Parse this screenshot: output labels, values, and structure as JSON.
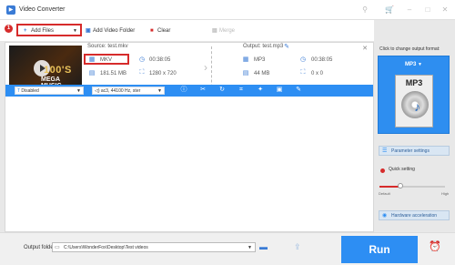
{
  "window": {
    "title": "Video Converter",
    "controls": [
      "key-icon",
      "cart-icon",
      "minimize-icon",
      "maximize-icon",
      "close-icon"
    ]
  },
  "toolbar": {
    "add_files": "Add Files",
    "add_folder": "Add Video Folder",
    "clear": "Clear",
    "merge": "Merge"
  },
  "step_badge": "1",
  "source": {
    "label": "Source: test.mkv",
    "format": "MKV",
    "duration": "00:38:05",
    "size": "181.51 MB",
    "resolution": "1280 x 720"
  },
  "output": {
    "label": "Output: test.mp3",
    "format": "MP3",
    "duration": "00:38:05",
    "size": "44 MB",
    "resolution": "0 x 0"
  },
  "thumbnail": {
    "line1": "100'S",
    "line2": "MEGA MUSIC"
  },
  "subtitle_select": "Disabled",
  "audio_select": "ac3, 44100 Hz, ster",
  "right_panel": {
    "title": "Click to change output format:",
    "format": "MP3",
    "format_icon_label": "MP3",
    "parameter_settings": "Parameter settings",
    "quick_setting": "Quick setting",
    "slider_default": "Default",
    "slider_high": "High",
    "hardware_acceleration": "Hardware acceleration"
  },
  "bottom": {
    "output_folder_label": "Output folder:",
    "output_folder_path": "C:\\Users\\WonderFox\\Desktop\\Test videos",
    "run": "Run"
  },
  "colors": {
    "accent": "#2d8ef3",
    "highlight": "#d62b2b"
  }
}
